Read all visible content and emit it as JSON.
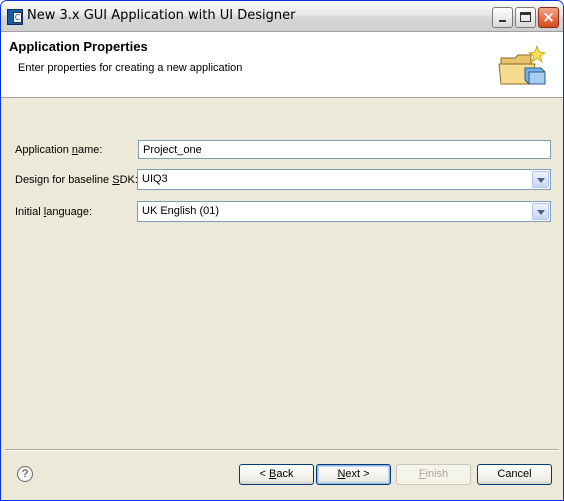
{
  "window": {
    "title": "New 3.x GUI Application with UI Designer",
    "app_icon_glyph": "C"
  },
  "header": {
    "title": "Application Properties",
    "description": "Enter properties for creating a new application"
  },
  "form": {
    "app_name": {
      "label_pre": "Application ",
      "label_accel": "n",
      "label_post": "ame:",
      "value": "Project_one"
    },
    "sdk": {
      "label_pre": "Design for baseline ",
      "label_accel": "S",
      "label_post": "DK:",
      "value": "UIQ3"
    },
    "language": {
      "label_pre": "Initial ",
      "label_accel": "l",
      "label_post": "anguage:",
      "value": "UK English (01)"
    }
  },
  "buttons": {
    "help": "?",
    "back_pre": "< ",
    "back_accel": "B",
    "back_post": "ack",
    "next_accel": "N",
    "next_post": "ext >",
    "finish_accel": "F",
    "finish_post": "inish",
    "cancel": "Cancel"
  },
  "colors": {
    "title_bar_border": "#0831d9",
    "dialog_bg": "#ece9d8",
    "close_button": "#d24a20",
    "input_border": "#7f9db9"
  }
}
